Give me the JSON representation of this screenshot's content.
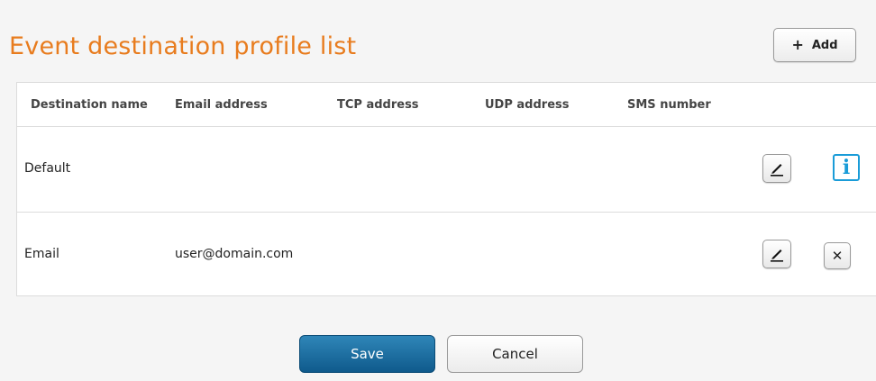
{
  "page": {
    "title": "Event destination profile list",
    "title_color": "#e87c1e"
  },
  "toolbar": {
    "add_icon": "plus-icon",
    "add_label": "Add"
  },
  "table": {
    "columns": [
      "Destination name",
      "Email address",
      "TCP address",
      "UDP address",
      "SMS number"
    ],
    "rows": [
      {
        "destination_name": "Default",
        "email_address": "",
        "tcp_address": "",
        "udp_address": "",
        "sms_number": "",
        "actions": [
          "edit-icon",
          "info-icon"
        ]
      },
      {
        "destination_name": "Email",
        "email_address": "user@domain.com",
        "tcp_address": "",
        "udp_address": "",
        "sms_number": "",
        "actions": [
          "edit-icon",
          "delete-icon"
        ]
      }
    ]
  },
  "footer": {
    "save_label": "Save",
    "cancel_label": "Cancel",
    "save_color": "#0f5a8c"
  },
  "icons": {
    "delete_glyph": "✕",
    "info_glyph": "i"
  },
  "colors": {
    "info_icon": "#1a9cd8"
  }
}
